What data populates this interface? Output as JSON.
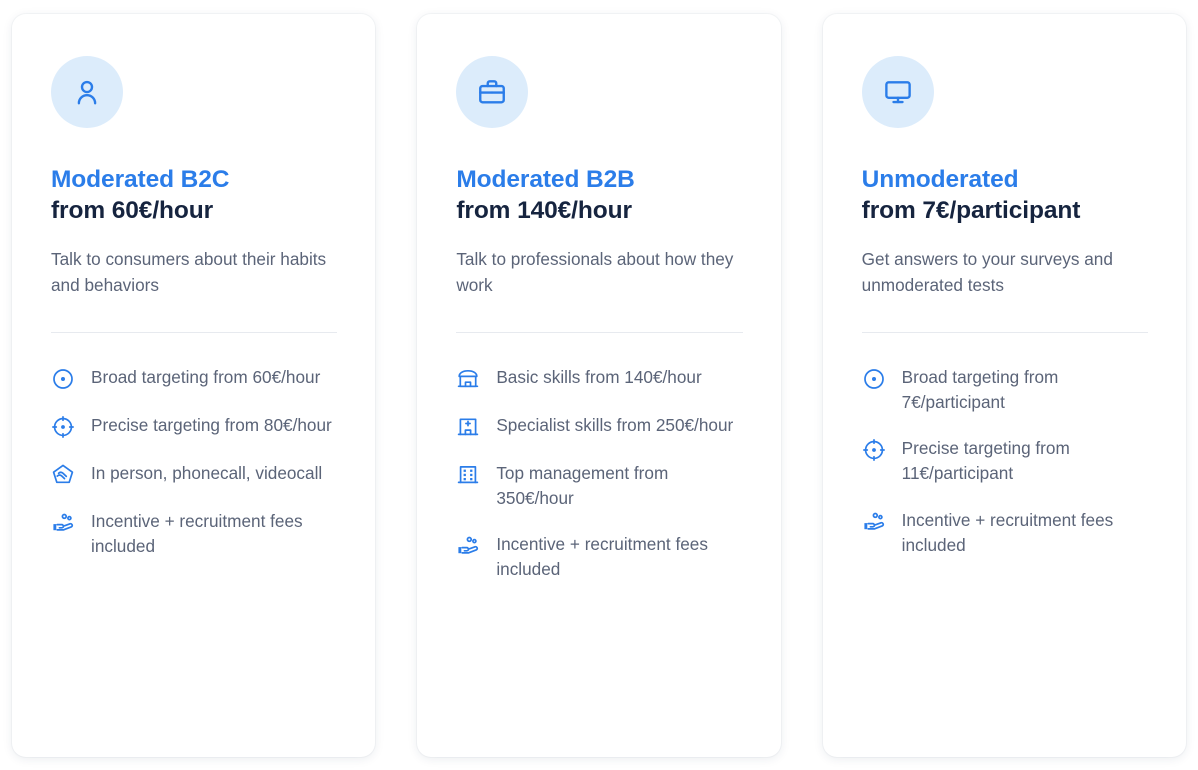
{
  "board": {
    "accent_blue": "#2b7de9",
    "price_navy": "#16243f",
    "body_gray": "#5b6478",
    "icon_badge_bg": "#dcecfb",
    "card_bg": "#ffffff",
    "divider": "#e7eaef",
    "page_bg": "#ffffff"
  },
  "cards": [
    {
      "badge_icon": "person-icon",
      "title": "Moderated B2C",
      "price": "from 60€/hour",
      "description": "Talk to consumers about their habits and behaviors",
      "features": [
        {
          "icon": "target-broad-icon",
          "text": "Broad targeting from 60€/hour"
        },
        {
          "icon": "target-precise-icon",
          "text": "Precise targeting from 80€/hour"
        },
        {
          "icon": "handshake-icon",
          "text": "In person, phonecall, videocall"
        },
        {
          "icon": "hand-people-icon",
          "text": "Incentive + recruitment fees included"
        }
      ]
    },
    {
      "badge_icon": "briefcase-icon",
      "title": "Moderated B2B",
      "price": "from 140€/hour",
      "description": "Talk to professionals about how they work",
      "features": [
        {
          "icon": "storefront-icon",
          "text": "Basic skills from 140€/hour"
        },
        {
          "icon": "hospital-icon",
          "text": "Specialist skills from 250€/hour"
        },
        {
          "icon": "office-building-icon",
          "text": "Top management from 350€/hour"
        },
        {
          "icon": "hand-people-icon",
          "text": "Incentive + recruitment fees included"
        }
      ]
    },
    {
      "badge_icon": "monitor-icon",
      "title": "Unmoderated",
      "price": "from 7€/participant",
      "description": "Get answers to your surveys and unmoderated tests",
      "features": [
        {
          "icon": "target-broad-icon",
          "text": "Broad targeting from 7€/participant"
        },
        {
          "icon": "target-precise-icon",
          "text": "Precise targeting from 11€/participant"
        },
        {
          "icon": "hand-people-icon",
          "text": "Incentive + recruitment fees included"
        }
      ]
    }
  ]
}
